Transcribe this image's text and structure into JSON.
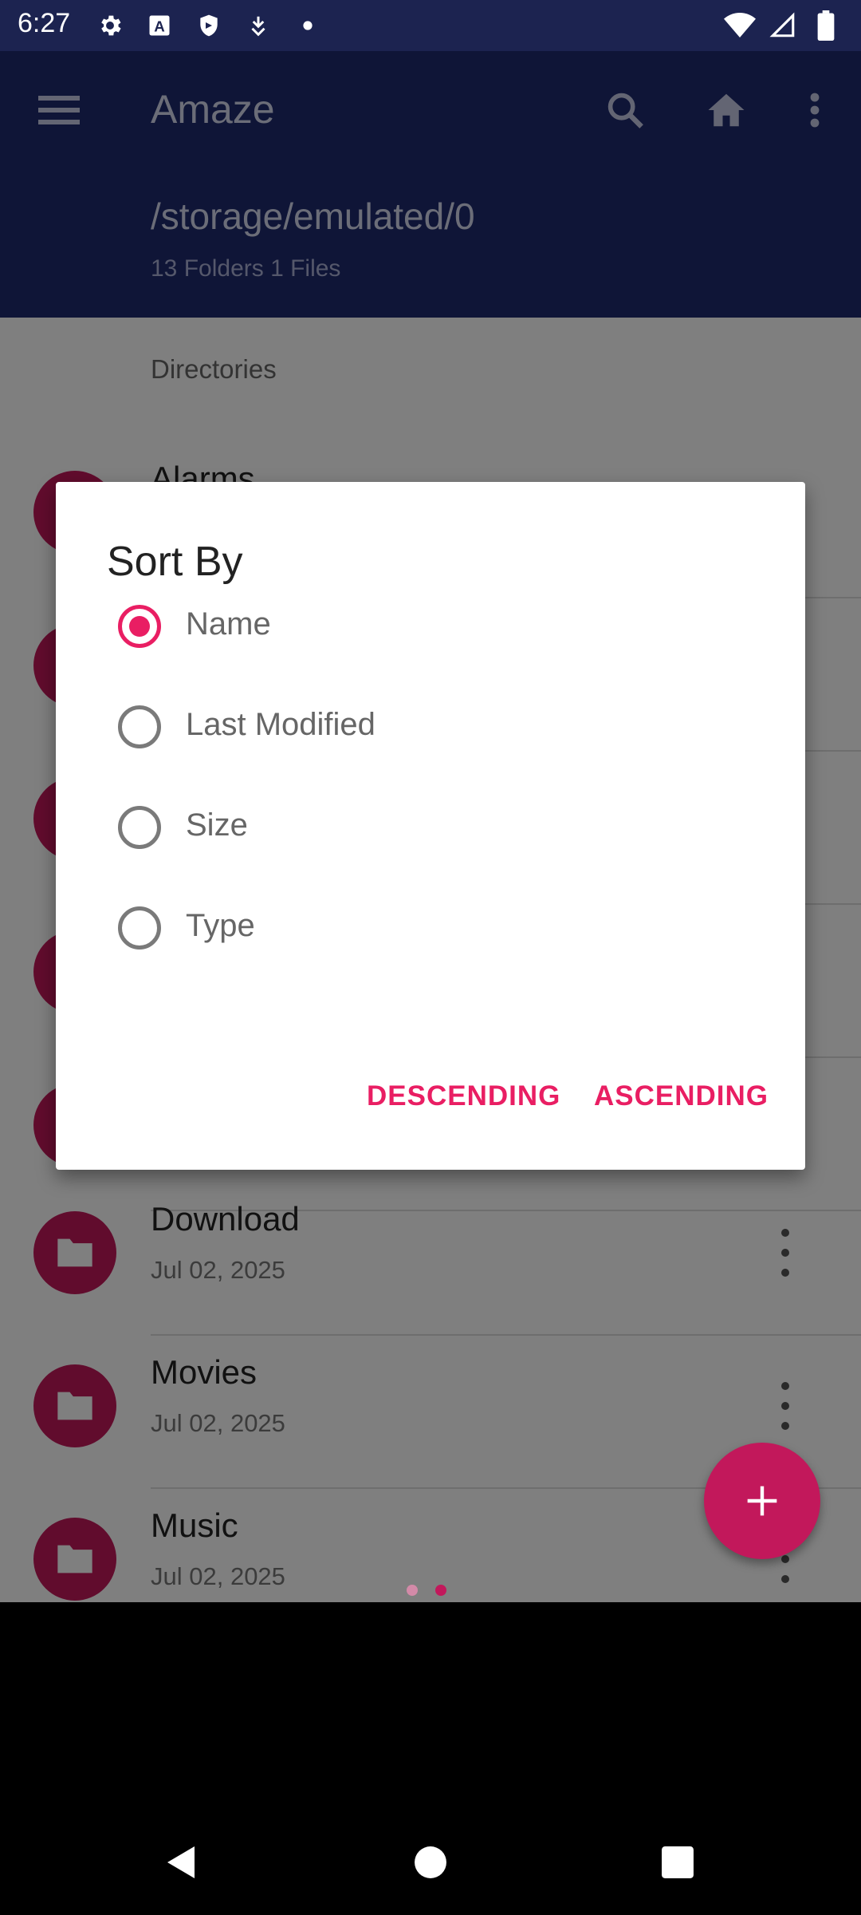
{
  "status_bar": {
    "time": "6:27",
    "left_icons": [
      "gear-icon",
      "keyboard-a-icon",
      "shield-icon",
      "download-icon",
      "dot-icon"
    ],
    "right_icons": [
      "wifi-icon",
      "signal-icon",
      "battery-icon"
    ]
  },
  "toolbar": {
    "title": "Amaze",
    "path": "/storage/emulated/0",
    "summary": "13 Folders 1 Files"
  },
  "list": {
    "section_header": "Directories",
    "items": [
      {
        "name": "Alarms",
        "date": ""
      },
      {
        "name": "Download",
        "date": "Jul 02, 2025"
      },
      {
        "name": "Movies",
        "date": "Jul 02, 2025"
      },
      {
        "name": "Music",
        "date": "Jul 02, 2025"
      }
    ]
  },
  "dialog": {
    "title": "Sort By",
    "options": [
      {
        "label": "Name",
        "selected": true
      },
      {
        "label": "Last Modified",
        "selected": false
      },
      {
        "label": "Size",
        "selected": false
      },
      {
        "label": "Type",
        "selected": false
      }
    ],
    "descending_label": "DESCENDING",
    "ascending_label": "ASCENDING"
  },
  "colors": {
    "primary": "#1f2a6e",
    "status_bar": "#1c2350",
    "accent": "#e91e63",
    "folder": "#c2185b"
  },
  "fab": {
    "icon": "plus-icon"
  }
}
